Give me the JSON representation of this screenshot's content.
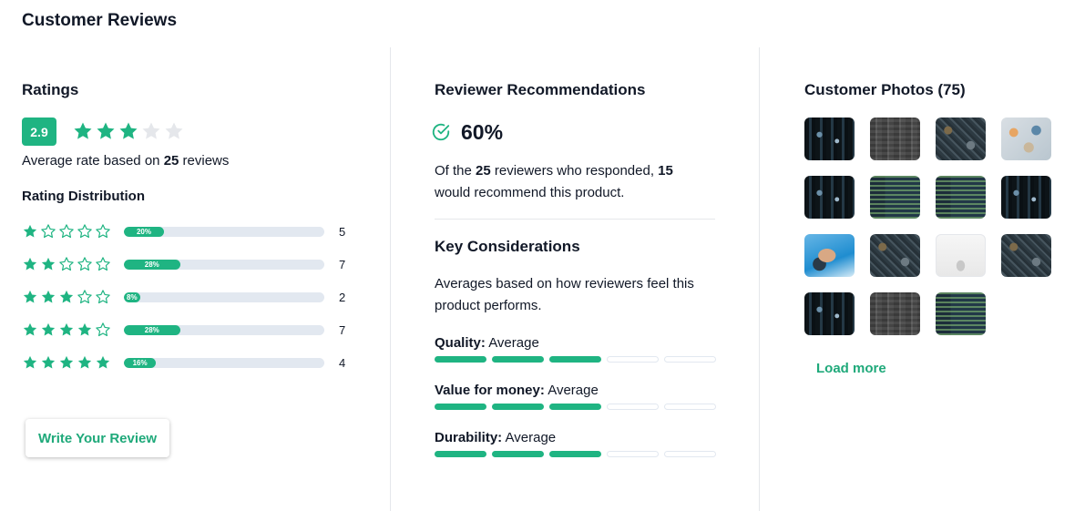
{
  "page_title": "Customer Reviews",
  "colors": {
    "accent": "#1fb482",
    "accent_text": "#1fa97a",
    "track": "#e2e8f0",
    "star_empty": "#e5e7eb"
  },
  "ratings": {
    "heading": "Ratings",
    "score": "2.9",
    "filled_stars": 3,
    "total_stars": 5,
    "avg_prefix": "Average rate based on",
    "review_count": "25",
    "avg_suffix": "reviews",
    "distribution_title": "Rating Distribution",
    "distribution": [
      {
        "stars": 1,
        "percent_label": "20%",
        "percent": 20,
        "count": "5"
      },
      {
        "stars": 2,
        "percent_label": "28%",
        "percent": 28,
        "count": "7"
      },
      {
        "stars": 3,
        "percent_label": "8%",
        "percent": 8,
        "count": "2"
      },
      {
        "stars": 4,
        "percent_label": "28%",
        "percent": 28,
        "count": "7"
      },
      {
        "stars": 5,
        "percent_label": "16%",
        "percent": 16,
        "count": "4"
      }
    ],
    "write_review_label": "Write Your Review"
  },
  "recommendations": {
    "heading": "Reviewer Recommendations",
    "percent": "60%",
    "text_prefix": "Of the",
    "responded": "25",
    "text_middle": "reviewers who responded,",
    "recommend_count": "15",
    "text_suffix": "would recommend this product.",
    "icon": "check-circle-icon"
  },
  "considerations": {
    "heading": "Key Considerations",
    "description": "Averages based on how reviewers feel this product performs.",
    "items": [
      {
        "label": "Quality:",
        "value": "Average",
        "level": 3,
        "max": 5
      },
      {
        "label": "Value for money:",
        "value": "Average",
        "level": 3,
        "max": 5
      },
      {
        "label": "Durability:",
        "value": "Average",
        "level": 3,
        "max": 5
      }
    ]
  },
  "photos": {
    "heading": "Customer Photos (75)",
    "items": [
      "dark-circuit",
      "gray-keyboard",
      "circuit-board",
      "desk-flatlay",
      "dark-circuit",
      "code-screen",
      "code-screen",
      "dark-circuit",
      "hand-wristwatch",
      "circuit-board",
      "white-laptop",
      "circuit-board",
      "dark-circuit",
      "gray-keyboard",
      "code-screen"
    ],
    "load_more_label": "Load more"
  }
}
